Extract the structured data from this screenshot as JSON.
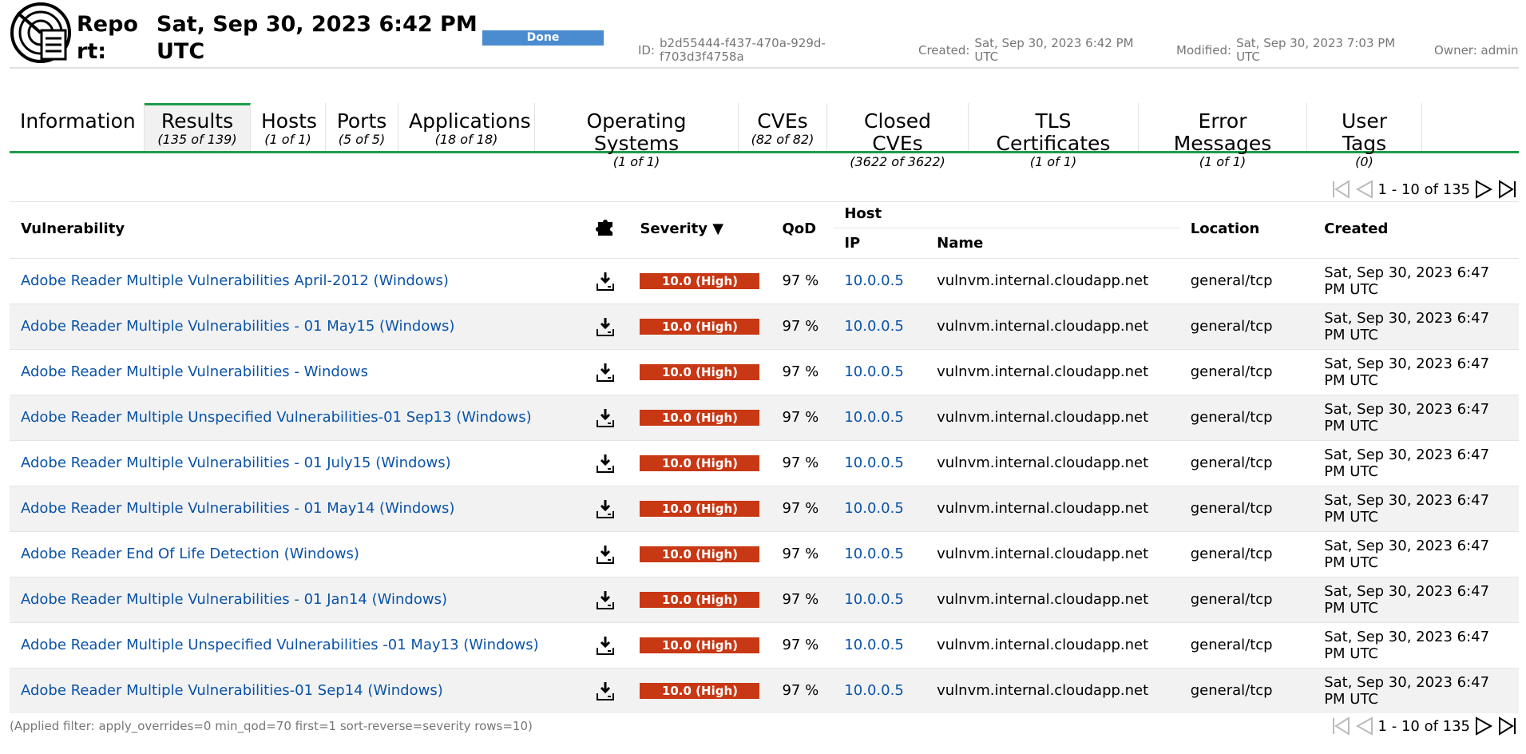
{
  "report": {
    "title_label": "Report:",
    "date": "Sat, Sep 30, 2023 6:42 PM UTC",
    "status": "Done",
    "id_label": "ID:",
    "id_value": "b2d55444-f437-470a-929d-f703d3f4758a",
    "created_label": "Created:",
    "created_value": "Sat, Sep 30, 2023 6:42 PM UTC",
    "modified_label": "Modified:",
    "modified_value": "Sat, Sep 30, 2023 7:03 PM UTC",
    "owner": "Owner: admin"
  },
  "tabs": [
    {
      "name": "Information",
      "count": ""
    },
    {
      "name": "Results",
      "count": "(135 of 139)"
    },
    {
      "name": "Hosts",
      "count": "(1 of 1)"
    },
    {
      "name": "Ports",
      "count": "(5 of 5)"
    },
    {
      "name": "Applications",
      "count": "(18 of 18)"
    },
    {
      "name": "Operating Systems",
      "count": "(1 of 1)"
    },
    {
      "name": "CVEs",
      "count": "(82 of 82)"
    },
    {
      "name": "Closed CVEs",
      "count": "(3622 of 3622)"
    },
    {
      "name": "TLS Certificates",
      "count": "(1 of 1)"
    },
    {
      "name": "Error Messages",
      "count": "(1 of 1)"
    },
    {
      "name": "User Tags",
      "count": "(0)"
    }
  ],
  "pagination": {
    "text": "1 - 10 of 135"
  },
  "table": {
    "headers": {
      "vulnerability": "Vulnerability",
      "severity": "Severity ▼",
      "qod": "QoD",
      "host": "Host",
      "ip": "IP",
      "name": "Name",
      "location": "Location",
      "created": "Created"
    },
    "rows": [
      {
        "vuln": "Adobe Reader Multiple Vulnerabilities April-2012 (Windows)",
        "severity": "10.0 (High)",
        "qod": "97 %",
        "ip": "10.0.0.5",
        "name": "vulnvm.internal.cloudapp.net",
        "location": "general/tcp",
        "created": "Sat, Sep 30, 2023 6:47 PM UTC"
      },
      {
        "vuln": "Adobe Reader Multiple Vulnerabilities - 01 May15 (Windows)",
        "severity": "10.0 (High)",
        "qod": "97 %",
        "ip": "10.0.0.5",
        "name": "vulnvm.internal.cloudapp.net",
        "location": "general/tcp",
        "created": "Sat, Sep 30, 2023 6:47 PM UTC"
      },
      {
        "vuln": "Adobe Reader Multiple Vulnerabilities - Windows",
        "severity": "10.0 (High)",
        "qod": "97 %",
        "ip": "10.0.0.5",
        "name": "vulnvm.internal.cloudapp.net",
        "location": "general/tcp",
        "created": "Sat, Sep 30, 2023 6:47 PM UTC"
      },
      {
        "vuln": "Adobe Reader Multiple Unspecified Vulnerabilities-01 Sep13 (Windows)",
        "severity": "10.0 (High)",
        "qod": "97 %",
        "ip": "10.0.0.5",
        "name": "vulnvm.internal.cloudapp.net",
        "location": "general/tcp",
        "created": "Sat, Sep 30, 2023 6:47 PM UTC"
      },
      {
        "vuln": "Adobe Reader Multiple Vulnerabilities - 01 July15 (Windows)",
        "severity": "10.0 (High)",
        "qod": "97 %",
        "ip": "10.0.0.5",
        "name": "vulnvm.internal.cloudapp.net",
        "location": "general/tcp",
        "created": "Sat, Sep 30, 2023 6:47 PM UTC"
      },
      {
        "vuln": "Adobe Reader Multiple Vulnerabilities - 01 May14 (Windows)",
        "severity": "10.0 (High)",
        "qod": "97 %",
        "ip": "10.0.0.5",
        "name": "vulnvm.internal.cloudapp.net",
        "location": "general/tcp",
        "created": "Sat, Sep 30, 2023 6:47 PM UTC"
      },
      {
        "vuln": "Adobe Reader End Of Life Detection (Windows)",
        "severity": "10.0 (High)",
        "qod": "97 %",
        "ip": "10.0.0.5",
        "name": "vulnvm.internal.cloudapp.net",
        "location": "general/tcp",
        "created": "Sat, Sep 30, 2023 6:47 PM UTC"
      },
      {
        "vuln": "Adobe Reader Multiple Vulnerabilities - 01 Jan14 (Windows)",
        "severity": "10.0 (High)",
        "qod": "97 %",
        "ip": "10.0.0.5",
        "name": "vulnvm.internal.cloudapp.net",
        "location": "general/tcp",
        "created": "Sat, Sep 30, 2023 6:47 PM UTC"
      },
      {
        "vuln": "Adobe Reader Multiple Unspecified Vulnerabilities -01 May13 (Windows)",
        "severity": "10.0 (High)",
        "qod": "97 %",
        "ip": "10.0.0.5",
        "name": "vulnvm.internal.cloudapp.net",
        "location": "general/tcp",
        "created": "Sat, Sep 30, 2023 6:47 PM UTC"
      },
      {
        "vuln": "Adobe Reader Multiple Vulnerabilities-01 Sep14 (Windows)",
        "severity": "10.0 (High)",
        "qod": "97 %",
        "ip": "10.0.0.5",
        "name": "vulnvm.internal.cloudapp.net",
        "location": "general/tcp",
        "created": "Sat, Sep 30, 2023 6:47 PM UTC"
      }
    ]
  },
  "filter_text": "(Applied filter: apply_overrides=0 min_qod=70 first=1 sort-reverse=severity rows=10)",
  "colors": {
    "accent_green": "#1e9c49",
    "status_blue": "#4a8ccf",
    "severity_high": "#c83814",
    "link_blue": "#0a53a8"
  },
  "icons": {
    "logo": "report-radar-icon",
    "plugin": "puzzle-icon",
    "download": "download-icon",
    "first": "first-page-icon",
    "prev": "previous-page-icon",
    "next": "next-page-icon",
    "last": "last-page-icon"
  }
}
